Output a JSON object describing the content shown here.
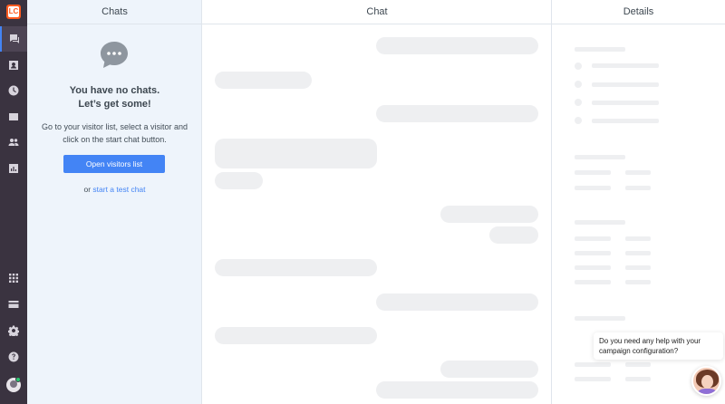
{
  "brand": {
    "logo_text": "LC",
    "accent": "#4384f5",
    "rail_bg": "#3a3340"
  },
  "nav": {
    "items": [
      {
        "name": "chats",
        "icon": "chat-icon",
        "active": true
      },
      {
        "name": "visitors",
        "icon": "contacts-icon"
      },
      {
        "name": "archives",
        "icon": "clock-icon"
      },
      {
        "name": "tickets",
        "icon": "ticket-icon"
      },
      {
        "name": "customers",
        "icon": "people-icon"
      },
      {
        "name": "reports",
        "icon": "chart-icon"
      },
      {
        "name": "apps",
        "icon": "grid-icon"
      },
      {
        "name": "billing",
        "icon": "card-icon"
      },
      {
        "name": "settings",
        "icon": "gear-icon"
      },
      {
        "name": "help",
        "icon": "help-icon"
      }
    ]
  },
  "chats_panel": {
    "header": "Chats",
    "empty_title_line1": "You have no chats.",
    "empty_title_line2": "Let’s get some!",
    "empty_desc": "Go to your visitor list, select a visitor and click on the start chat button.",
    "open_button": "Open visitors list",
    "or_text": "or",
    "test_link": "start a test chat"
  },
  "chat_panel": {
    "header": "Chat"
  },
  "details_panel": {
    "header": "Details"
  },
  "help_widget": {
    "message": "Do you need any help with your campaign configuration?"
  }
}
